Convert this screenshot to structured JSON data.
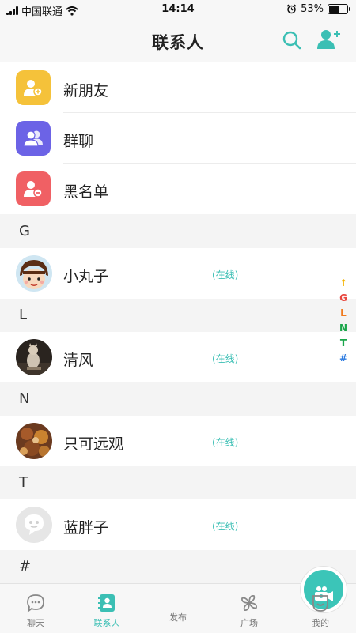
{
  "status_bar": {
    "carrier": "中国联通",
    "time": "14:14",
    "battery": "53%",
    "battery_level": 0.53
  },
  "header": {
    "title": "联系人"
  },
  "menu": [
    {
      "label": "新朋友",
      "icon": "add-user-icon",
      "color": "#f5c23a"
    },
    {
      "label": "群聊",
      "icon": "group-icon",
      "color": "#6c63e6"
    },
    {
      "label": "黑名单",
      "icon": "block-user-icon",
      "color": "#f06064"
    }
  ],
  "sections": [
    {
      "letter": "G",
      "contacts": [
        {
          "name": "小丸子",
          "status": "(在线)"
        }
      ]
    },
    {
      "letter": "L",
      "contacts": [
        {
          "name": "清风",
          "status": "(在线)"
        }
      ]
    },
    {
      "letter": "N",
      "contacts": [
        {
          "name": "只可远观",
          "status": "(在线)"
        }
      ]
    },
    {
      "letter": "T",
      "contacts": [
        {
          "name": "蓝胖子",
          "status": "(在线)"
        }
      ]
    },
    {
      "letter": "#",
      "contacts": []
    }
  ],
  "index_bar": [
    {
      "label": "↑",
      "color": "#f5b400"
    },
    {
      "label": "G",
      "color": "#e8473f"
    },
    {
      "label": "L",
      "color": "#f07a1e"
    },
    {
      "label": "N",
      "color": "#1aa64a"
    },
    {
      "label": "T",
      "color": "#1aa64a"
    },
    {
      "label": "#",
      "color": "#2f7de1"
    }
  ],
  "tabs": [
    {
      "label": "聊天",
      "icon": "chat-icon"
    },
    {
      "label": "联系人",
      "icon": "contacts-icon",
      "active": true
    },
    {
      "label": "发布",
      "icon": "video-camera-icon"
    },
    {
      "label": "广场",
      "icon": "pinwheel-icon"
    },
    {
      "label": "我的",
      "icon": "profile-icon"
    }
  ],
  "colors": {
    "accent": "#3bbfb4",
    "background": "#f4f4f4"
  }
}
